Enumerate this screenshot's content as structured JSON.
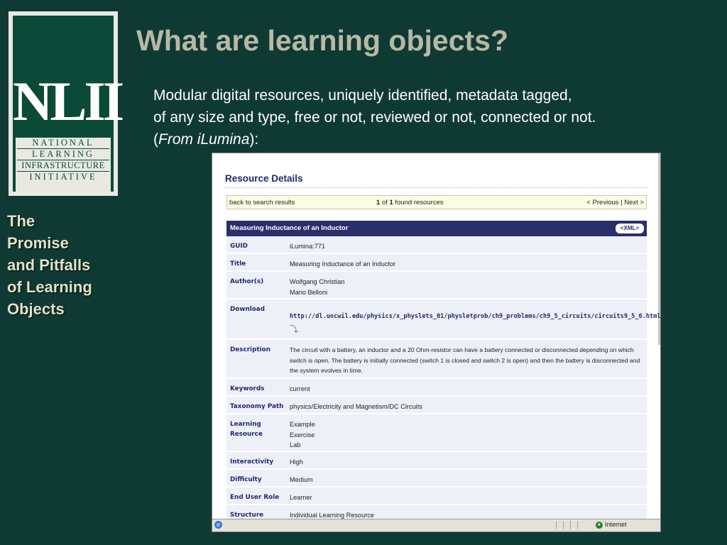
{
  "logo": {
    "abbr": "NLII",
    "lines": [
      "NATIONAL",
      "LEARNING",
      "INFRASTRUCTURE",
      "INITIATIVE"
    ]
  },
  "sidebar_title": [
    "The",
    "Promise",
    "and Pitfalls",
    "of Learning",
    "Objects"
  ],
  "slide": {
    "title": "What are learning objects?",
    "line1": "Modular digital resources, uniquely identified, metadata tagged,",
    "line2": "of any size and type, free or not, reviewed or not, connected or not.",
    "line3_open": "(",
    "line3_italic": "From iLumina",
    "line3_close": "):"
  },
  "screenshot": {
    "title": "Resource Details",
    "nav": {
      "back": "back to search results",
      "count_current": "1",
      "count_of": " of ",
      "count_total": "1",
      "count_suffix": " found resources",
      "prev": "< Previous",
      "sep": " | ",
      "next": "Next >"
    },
    "header": "Measuring Inductance of an Inductor",
    "xml_badge": "<XML>",
    "fields": {
      "guid": {
        "label": "GUID",
        "value": "iLumina:771"
      },
      "title": {
        "label": "Title",
        "value": "Measuring Inductance of an Inductor"
      },
      "authors": {
        "label": "Author(s)",
        "values": [
          "Wolfgang Christian",
          "Mario Belloni"
        ]
      },
      "download": {
        "label": "Download",
        "value": "http://dl.uncwil.edu/physics/x_physlets_01/physletprob/ch9_problems/ch9_5_circuits/circuits9_5_6.html"
      },
      "description": {
        "label": "Description",
        "value": "The circuit with a battery, an inductor and a 20 Ohm-resistor can have a battery connected or disconnected depending on which switch is open. The battery is initially connected (switch 1 is closed and switch 2 is open) and then the battery is disconnected and the system evolves in time."
      },
      "keywords": {
        "label": "Keywords",
        "value": "current"
      },
      "taxonomy": {
        "label": "Taxonomy Path",
        "value": "physics/Electricity and Magnetism/DC Circuits"
      },
      "learning_resource": {
        "label1": "Learning",
        "label2": "Resource",
        "values": [
          "Example",
          "Exercise",
          "Lab"
        ]
      },
      "interactivity": {
        "label": "Interactivity",
        "value": "High"
      },
      "difficulty": {
        "label": "Difficulty",
        "value": "Medium"
      },
      "end_user_role": {
        "label": "End User Role",
        "value": "Learner"
      },
      "structure": {
        "label": "Structure",
        "value": "Individual Learning Resource"
      }
    },
    "status": {
      "zone": "Internet"
    }
  }
}
